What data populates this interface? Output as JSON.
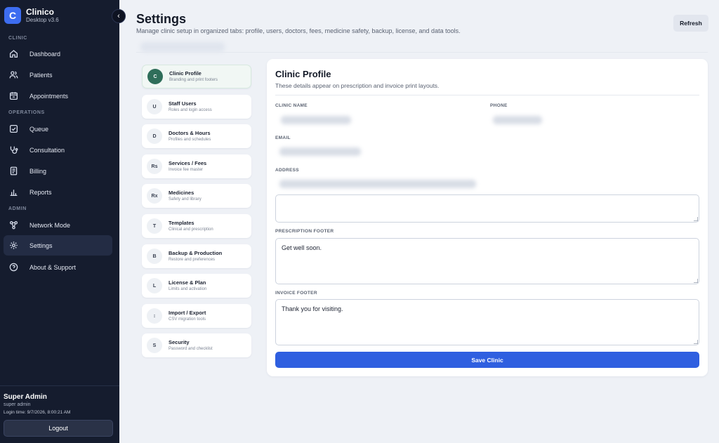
{
  "app": {
    "logo_letter": "C",
    "name": "Clinico",
    "version": "Desktop v3.6",
    "collapse_glyph": "‹"
  },
  "sidebar": {
    "sections": [
      "CLINIC",
      "OPERATIONS",
      "ADMIN"
    ],
    "items": [
      {
        "label": "Dashboard",
        "icon": "home-icon"
      },
      {
        "label": "Patients",
        "icon": "users-icon"
      },
      {
        "label": "Appointments",
        "icon": "calendar-icon"
      },
      {
        "label": "Queue",
        "icon": "checkbox-icon"
      },
      {
        "label": "Consultation",
        "icon": "stethoscope-icon"
      },
      {
        "label": "Billing",
        "icon": "document-icon"
      },
      {
        "label": "Reports",
        "icon": "bar-chart-icon"
      },
      {
        "label": "Network Mode",
        "icon": "network-icon"
      },
      {
        "label": "Settings",
        "icon": "gear-icon",
        "active": true
      },
      {
        "label": "About & Support",
        "icon": "help-icon"
      }
    ],
    "user": {
      "name": "Super Admin",
      "role": "super admin",
      "login_time": "Login time: 9/7/2026, 8:00:21 AM"
    },
    "logout_label": "Logout"
  },
  "header": {
    "title": "Settings",
    "subtitle": "Manage clinic setup in organized tabs: profile, users, doctors, fees, medicine safety, backup, license, and data tools.",
    "refresh_label": "Refresh"
  },
  "tabs": [
    {
      "badge": "C",
      "title": "Clinic Profile",
      "desc": "Branding and print footers",
      "active": true
    },
    {
      "badge": "U",
      "title": "Staff Users",
      "desc": "Roles and login access"
    },
    {
      "badge": "D",
      "title": "Doctors & Hours",
      "desc": "Profiles and schedules"
    },
    {
      "badge": "Rs",
      "title": "Services / Fees",
      "desc": "Invoice fee master"
    },
    {
      "badge": "Rx",
      "title": "Medicines",
      "desc": "Safety and library"
    },
    {
      "badge": "T",
      "title": "Templates",
      "desc": "Clinical and prescription"
    },
    {
      "badge": "B",
      "title": "Backup & Production",
      "desc": "Restore and preferences"
    },
    {
      "badge": "L",
      "title": "License & Plan",
      "desc": "Limits and activation"
    },
    {
      "badge": "↕",
      "title": "Import / Export",
      "desc": "CSV migration tools"
    },
    {
      "badge": "S",
      "title": "Security",
      "desc": "Password and checklist"
    }
  ],
  "clinic_profile": {
    "title": "Clinic Profile",
    "subtitle": "These details appear on prescription and invoice print layouts.",
    "labels": {
      "clinic_name": "CLINIC NAME",
      "phone": "PHONE",
      "email": "EMAIL",
      "address": "ADDRESS",
      "prescription_footer": "PRESCRIPTION FOOTER",
      "invoice_footer": "INVOICE FOOTER"
    },
    "prescription_footer_value": "Get well soon.",
    "invoice_footer_value": "Thank you for visiting.",
    "save_label": "Save Clinic"
  },
  "colors": {
    "sidebar_bg": "#151c2e",
    "accent": "#2f5fe0",
    "active_tab_badge": "#2f6e5a"
  }
}
